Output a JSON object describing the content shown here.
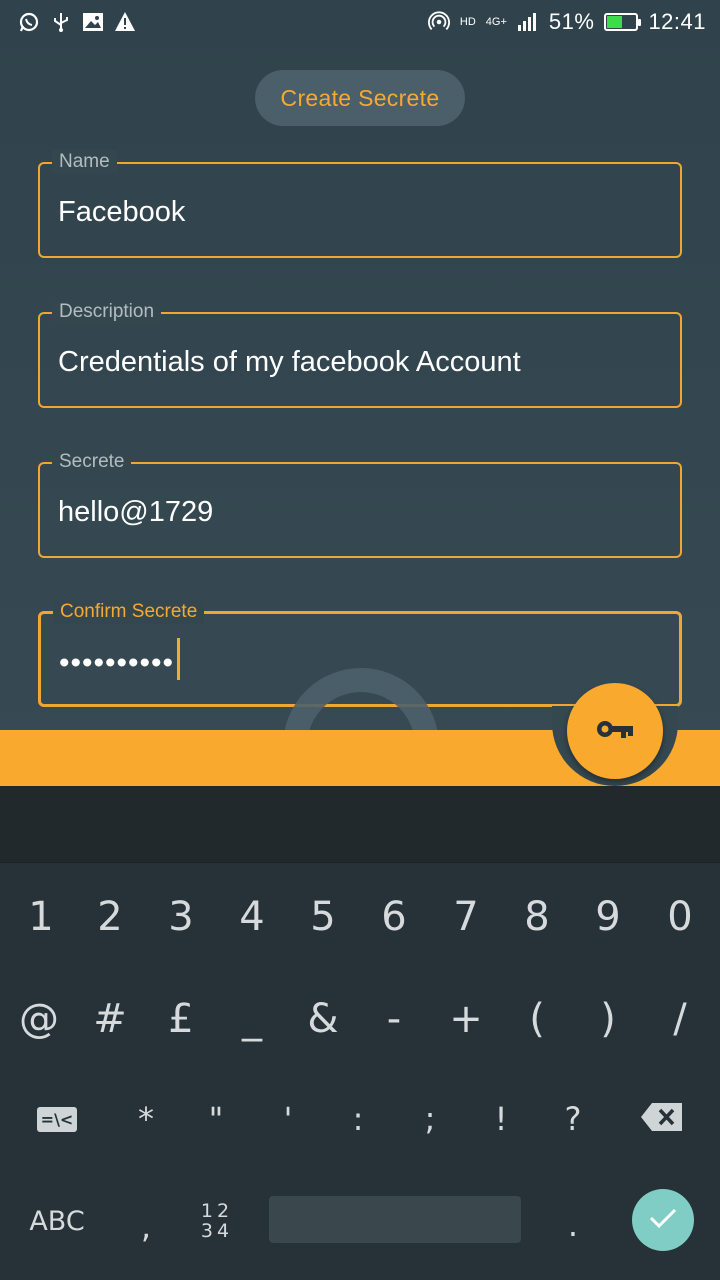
{
  "status_bar": {
    "left_icons": [
      "whatsapp-icon",
      "usb-icon",
      "image-icon",
      "warning-icon"
    ],
    "network_label": "4G+",
    "hd_label": "HD",
    "battery_percent": "51%",
    "battery_level": 0.51,
    "time": "12:41"
  },
  "header": {
    "title": "Create Secrete"
  },
  "form": {
    "name": {
      "label": "Name",
      "value": "Facebook"
    },
    "description": {
      "label": "Description",
      "value": "Credentials of my facebook Account"
    },
    "secrete": {
      "label": "Secrete",
      "value": "hello@1729"
    },
    "confirm": {
      "label": "Confirm Secrete",
      "value": "••••••••••"
    }
  },
  "fab": {
    "icon": "key-icon"
  },
  "keyboard": {
    "row1": [
      "1",
      "2",
      "3",
      "4",
      "5",
      "6",
      "7",
      "8",
      "9",
      "0"
    ],
    "row2": [
      "@",
      "#",
      "£",
      "_",
      "&",
      "-",
      "+",
      "(",
      ")",
      "/"
    ],
    "row3": [
      "*",
      "\"",
      "'",
      ":",
      ";",
      "!",
      "?"
    ],
    "sym_label": "=\\<",
    "abc_label": "ABC",
    "comma": ",",
    "num_top": "12",
    "num_bottom": "34",
    "period": "."
  },
  "colors": {
    "accent": "#f8a92e",
    "background": "#36474f",
    "enter": "#7fcdc4"
  }
}
